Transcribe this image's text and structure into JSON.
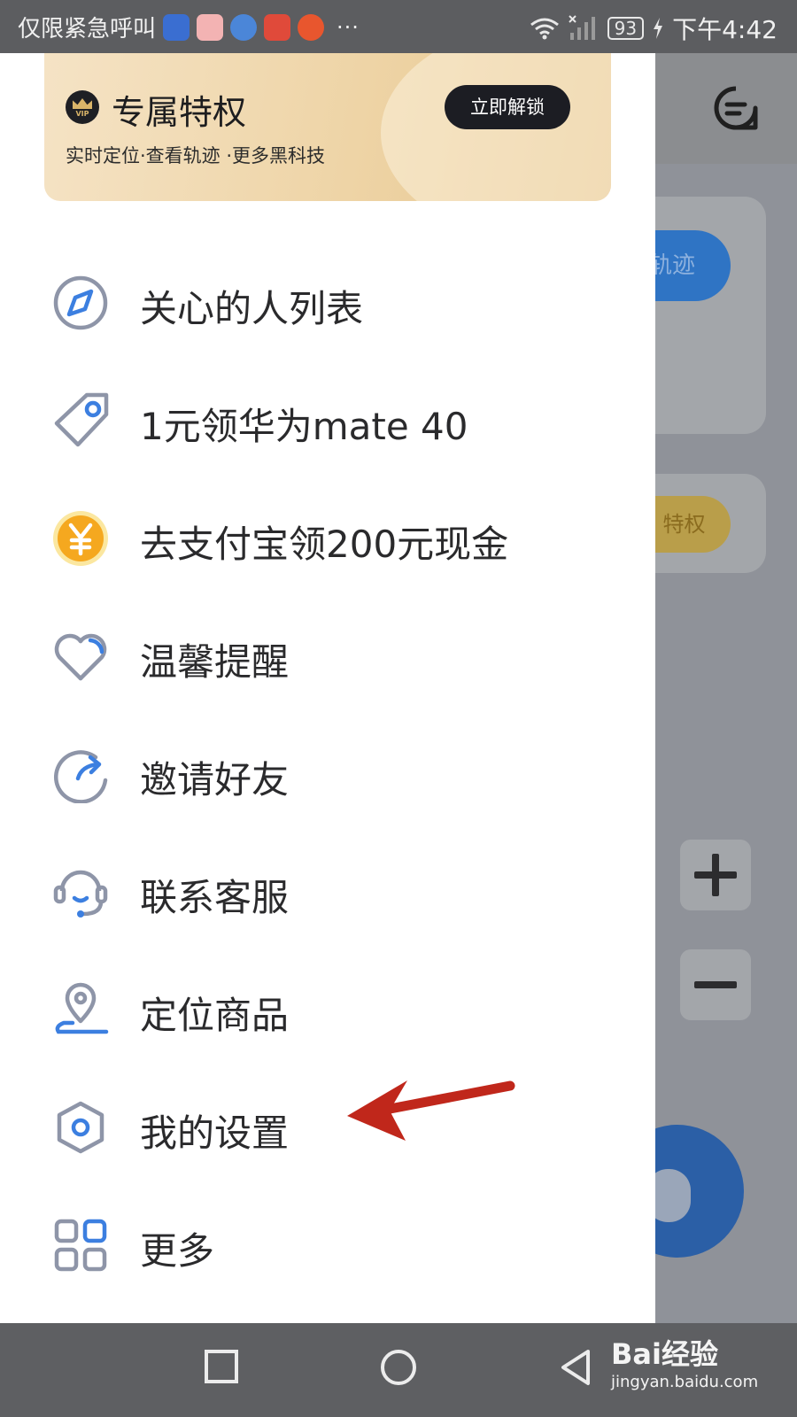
{
  "status_bar": {
    "carrier_text": "仅限紧急呼叫",
    "more_indicator": "···",
    "battery": "93",
    "time": "下午4:42"
  },
  "background_app": {
    "track_button": "轨迹",
    "privilege_button": "特权",
    "chat_icon": "chat-icon"
  },
  "vip_banner": {
    "badge_text": "VIP",
    "title": "专属特权",
    "subtitle": "实时定位·查看轨迹 ·更多黑科技",
    "unlock_button": "立即解锁"
  },
  "menu": {
    "items": [
      {
        "label": "关心的人列表",
        "icon": "compass-icon"
      },
      {
        "label": "1元领华为mate 40",
        "icon": "tag-icon"
      },
      {
        "label": "去支付宝领200元现金",
        "icon": "yen-coin-icon"
      },
      {
        "label": "温馨提醒",
        "icon": "heart-icon"
      },
      {
        "label": "邀请好友",
        "icon": "share-arrow-icon"
      },
      {
        "label": "联系客服",
        "icon": "headset-icon"
      },
      {
        "label": "定位商品",
        "icon": "location-pin-icon"
      },
      {
        "label": "我的设置",
        "icon": "hexagon-settings-icon"
      },
      {
        "label": "更多",
        "icon": "grid-icon"
      }
    ]
  },
  "watermark": {
    "logo": "Bai经验",
    "url": "jingyan.baidu.com"
  },
  "colors": {
    "accent_blue": "#3c7fe0",
    "icon_gray": "#8e95a8",
    "vip_gold": "#eed4a6",
    "annotation_red": "#c0271b"
  }
}
